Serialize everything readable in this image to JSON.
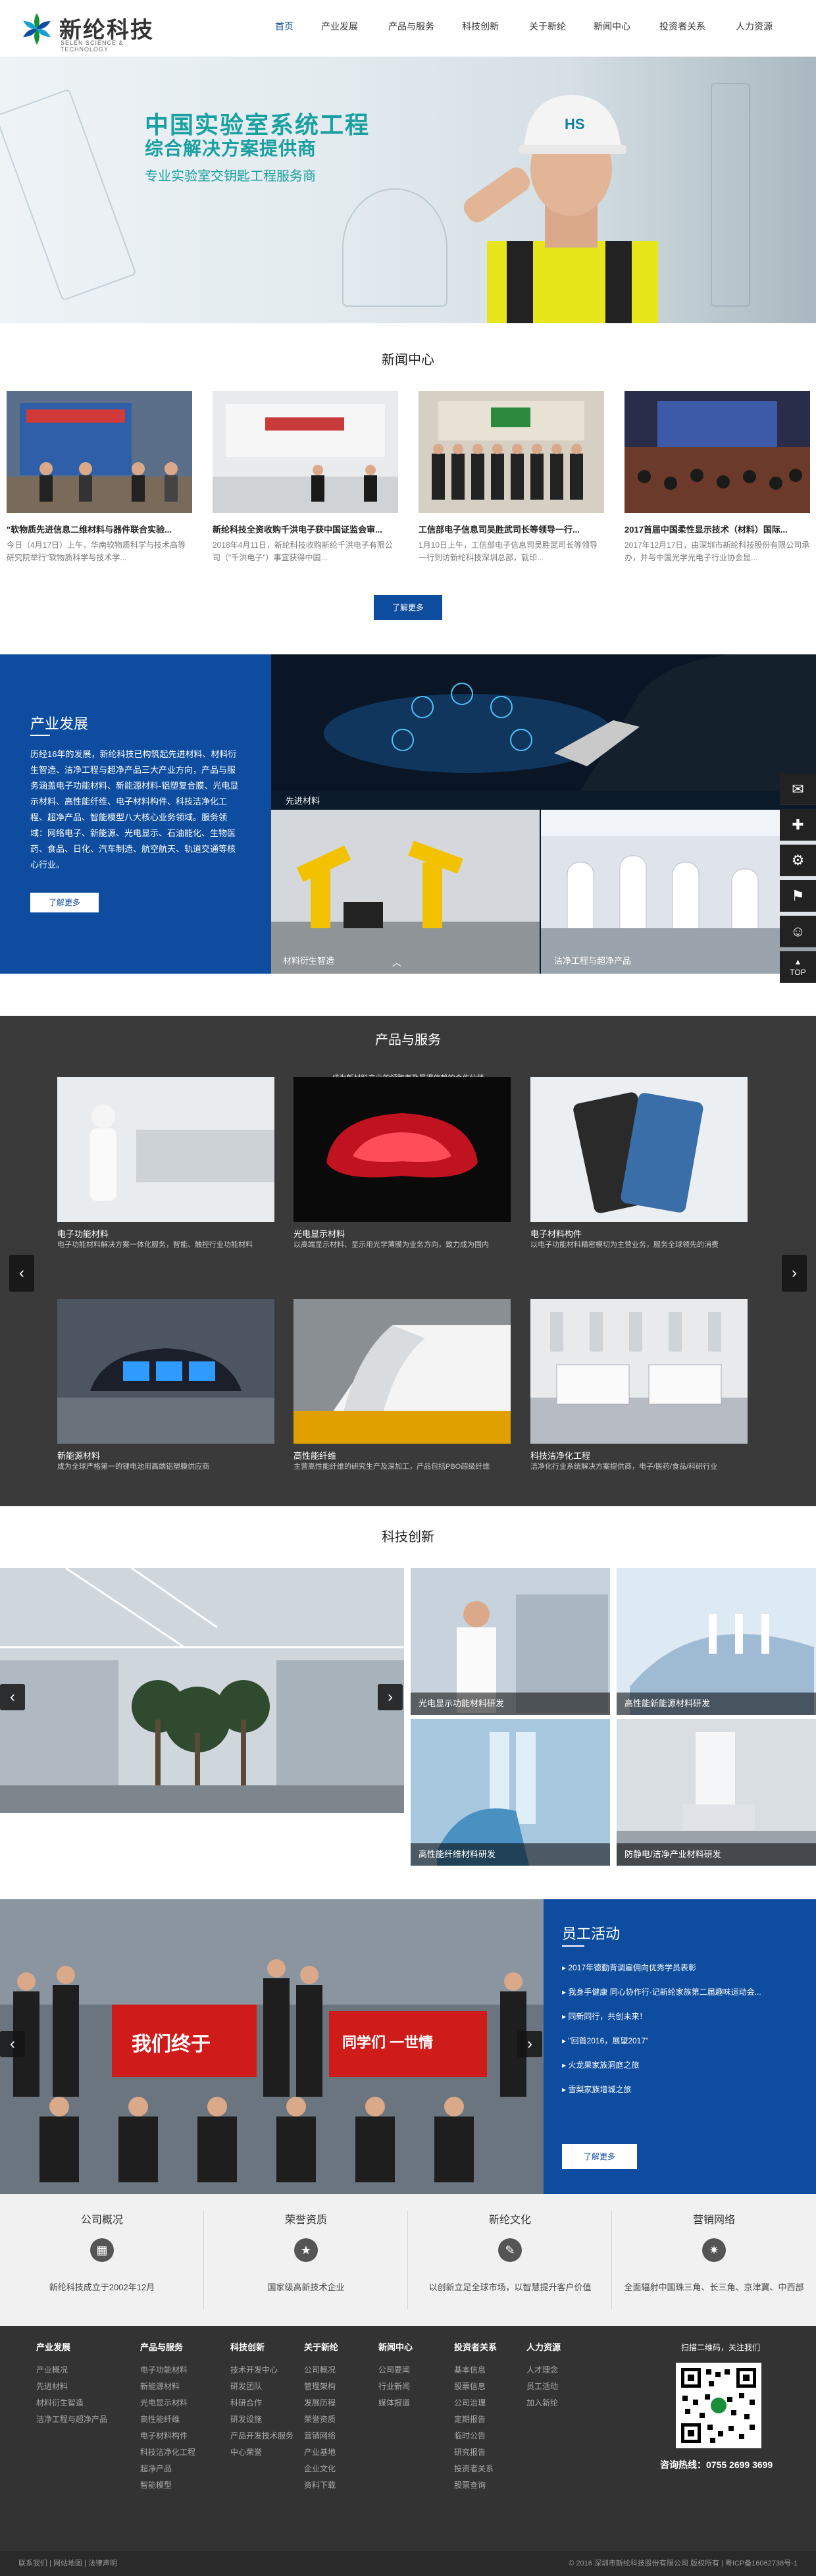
{
  "header": {
    "brand_name": "新纶科技",
    "brand_sub": "SELEN SCIENCE & TECHNOLOGY",
    "nav": [
      "首页",
      "产业发展",
      "产品与服务",
      "科技创新",
      "关于新纶",
      "新闻中心",
      "投资者关系",
      "人力资源"
    ],
    "active_nav": 0
  },
  "hero": {
    "title": "中国实验室系统工程",
    "subtitle": "综合解决方案提供商",
    "tagline": "专业实验室交钥匙工程服务商",
    "helmet_text": "HS",
    "slides": 3,
    "active_slide": 1
  },
  "news": {
    "title": "新闻中心",
    "items": [
      {
        "title": "\"软物质先进信息二维材料与器件联合实验...",
        "desc": "今日（4月17日）上午，华南软物质科学与技术高等研究院举行\"软物质科学与技术学..."
      },
      {
        "title": "新纶科技全资收购千洪电子获中国证监会审...",
        "desc": "2018年4月11日，新纶科技收购新纶千洪电子有限公司（\"千洪电子\"）事宜获得中国..."
      },
      {
        "title": "工信部电子信息司吴胜武司长等领导一行...",
        "desc": "1月10日上午，工信部电子信息司吴胜武司长等领导一行到访新纶科技深圳总部，就印..."
      },
      {
        "title": "2017首届中国柔性显示技术（材料）国际...",
        "desc": "2017年12月17日，由深圳市新纶科技股份有限公司承办，并与中国光学光电子行业协会显..."
      }
    ],
    "more_label": "了解更多"
  },
  "development": {
    "title": "产业发展",
    "desc": "历经16年的发展，新纶科技已构筑起先进材料、材料衍生智造、洁净工程与超净产品三大产业方向，产品与服务涵盖电子功能材料、新能源材料-铝塑复合膜、光电显示材料、高性能纤维、电子材料构件、科技洁净化工程、超净产品、智能模型八大核心业务领域。服务领域：网络电子、新能源、光电显示、石油能化、生物医药、食品、日化、汽车制造、航空航天、轨道交通等核心行业。",
    "more_label": "了解更多",
    "tiles": [
      "先进材料",
      "材料衍生智造",
      "洁净工程与超净产品"
    ]
  },
  "products": {
    "title": "产品与服务",
    "subtitle": "成为新材料产业的领跑者及最得信赖的合作伙伴",
    "items": [
      {
        "name": "电子功能材料",
        "desc": "电子功能材料解决方案一体化服务，智能、触控行业功能材料"
      },
      {
        "name": "光电显示材料",
        "desc": "以高端显示材料、显示用光学薄膜为业务方向，致力成为国内"
      },
      {
        "name": "电子材料构件",
        "desc": "以电子功能材料精密模切为主营业务，服务全球领先的消费"
      },
      {
        "name": "新能源材料",
        "desc": "成为全球严格第一的锂电池用高端铝塑膜供应商"
      },
      {
        "name": "高性能纤维",
        "desc": "主营高性能纤维的研究生产及深加工，产品包括PBO超级纤维"
      },
      {
        "name": "科技洁净化工程",
        "desc": "洁净化行业系统解决方案提供商，电子/医药/食品/科研行业"
      }
    ]
  },
  "tech": {
    "title": "科技创新",
    "tiles": [
      "光电显示功能材料研发",
      "高性能新能源材料研发",
      "高性能纤维材料研发",
      "防静电/洁净产业材料研发"
    ]
  },
  "staff": {
    "title": "员工活动",
    "items": [
      "2017年德勤背调雇佣向优秀学员表彰",
      "我身手健康 同心协作行·记新纶家族第二届趣味运动会...",
      "同新同行，共创未来！",
      "\"回首2016，展望2017\"",
      "火龙果家族洞庭之旅",
      "雪梨家族增城之旅"
    ],
    "banner_left": "我们终于",
    "banner_right": "同学们 一世情",
    "more_label": "了解更多"
  },
  "info_cards": [
    {
      "title": "公司概况",
      "icon": "building-icon",
      "desc": "新纶科技成立于2002年12月"
    },
    {
      "title": "荣誉资质",
      "icon": "award-icon",
      "desc": "国家级高新技术企业"
    },
    {
      "title": "新纶文化",
      "icon": "culture-icon",
      "desc": "以创新立足全球市场，以智慧提升客户价值"
    },
    {
      "title": "营销网络",
      "icon": "network-icon",
      "desc": "全面辐射中国珠三角、长三角、京津冀、中西部"
    }
  ],
  "footer": {
    "columns": [
      {
        "head": "产业发展",
        "links": [
          "产业概况",
          "先进材料",
          "材料衍生智造",
          "洁净工程与超净产品"
        ]
      },
      {
        "head": "产品与服务",
        "links": [
          "电子功能材料",
          "新能源材料",
          "光电显示材料",
          "高性能纤维",
          "电子材料构件",
          "科技洁净化工程",
          "超净产品",
          "智能模型"
        ]
      },
      {
        "head": "科技创新",
        "links": [
          "技术开发中心",
          "研发团队",
          "科研合作",
          "研发设施",
          "产品开发技术服务",
          "中心荣誉"
        ]
      },
      {
        "head": "关于新纶",
        "links": [
          "公司概况",
          "管理架构",
          "发展历程",
          "荣誉资质",
          "营销网络",
          "产业基地",
          "企业文化",
          "资料下载"
        ]
      },
      {
        "head": "新闻中心",
        "links": [
          "公司要闻",
          "行业新闻",
          "媒体报道"
        ]
      },
      {
        "head": "投资者关系",
        "links": [
          "基本信息",
          "股票信息",
          "公司治理",
          "定期报告",
          "临时公告",
          "研究报告",
          "投资者关系",
          "股票查询"
        ]
      },
      {
        "head": "人力资源",
        "links": [
          "人才理念",
          "员工活动",
          "加入新纶"
        ]
      }
    ],
    "qr_title": "扫描二维码，关注我们",
    "hotline_label": "咨询热线：0755 2699 3699",
    "bottom_links": "联系我们 | 网站地图 | 法律声明",
    "copyright": "© 2016 深圳市新纶科技股份有限公司 版权所有 | 粤ICP备16062738号-1"
  },
  "sidebar": [
    "chat-icon",
    "puzzle-icon",
    "gear-icon",
    "pin-icon",
    "user-icon",
    "TOP"
  ]
}
